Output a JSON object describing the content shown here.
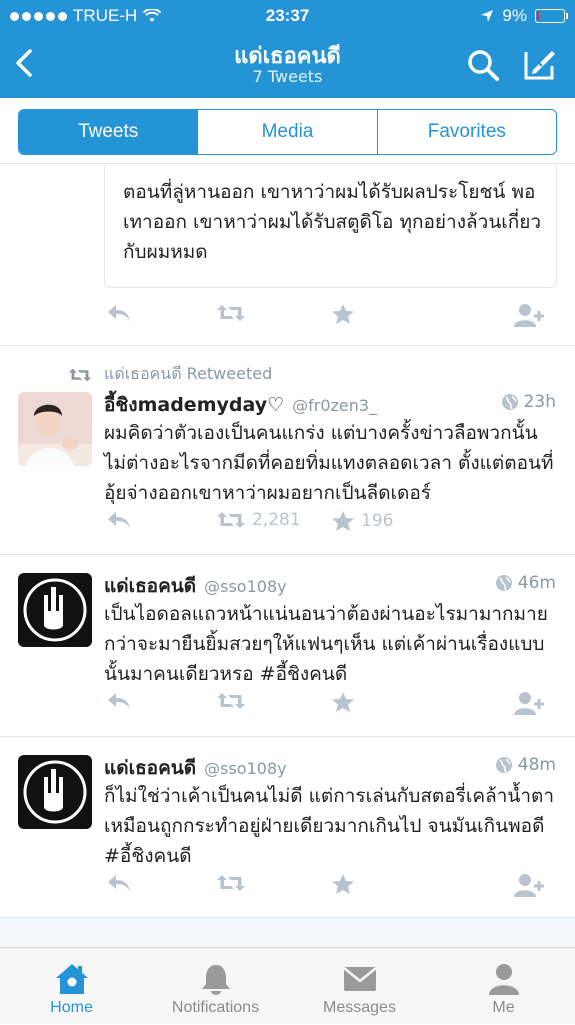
{
  "status_bar": {
    "carrier": "TRUE-H",
    "time": "23:37",
    "battery": "9%",
    "battery_level": 0.09
  },
  "nav": {
    "title": "แด่เธอคนดี",
    "subtitle": "7 Tweets"
  },
  "segments": [
    "Tweets",
    "Media",
    "Favorites"
  ],
  "active_segment": "Tweets",
  "quoted_tweet": {
    "text": "ตอนที่ลู่หานออก เขาหาว่าผมได้รับผลประโยชน์ พอเทาออก เขาหาว่าผมได้รับสตูดิโอ ทุกอย่างล้วนเกี่ยวกับผมหมด"
  },
  "tweets": [
    {
      "retweet_label": "แด่เธอคนดี Retweeted",
      "name": "อี้ชิงmademyday♡",
      "handle": "@fr0zen3_",
      "time": "23h",
      "text": "ผมคิดว่าตัวเองเป็นคนแกร่ง แต่บางครั้งข่าวลือพวกนั้นไม่ต่างอะไรจากมีดที่คอยทิ่มแทงตลอดเวลา ตั้งแต่ตอนที่อุ้ยจ่างออกเขาหาว่าผมอยากเป็นลีดเดอร์",
      "retweets": "2,281",
      "favorites": "196"
    },
    {
      "name": "แด่เธอคนดี",
      "handle": "@sso108y",
      "time": "46m",
      "text": "เป็นไอดอลแถวหน้าแน่นอนว่าต้องผ่านอะไรมามากมายกว่าจะมายืนยิ้มสวยๆให้แฟนๆเห็น แต่เค้าผ่านเรื่องแบบนั้นมาคนเดียวหรอ #อี้ชิงคนดี"
    },
    {
      "name": "แด่เธอคนดี",
      "handle": "@sso108y",
      "time": "48m",
      "text": "ก็ไม่ใช่ว่าเค้าเป็นคนไม่ดี แต่การเล่นกับสตอรี่เคล้าน้ำตา เหมือนถูกกระทำอยู่ฝ่ายเดียวมากเกินไป จนมันเกินพอดี #อี้ชิงคนดี"
    }
  ],
  "tabs": [
    {
      "label": "Home",
      "icon": "home-icon"
    },
    {
      "label": "Notifications",
      "icon": "bell-icon"
    },
    {
      "label": "Messages",
      "icon": "envelope-icon"
    },
    {
      "label": "Me",
      "icon": "person-icon"
    }
  ],
  "colors": {
    "brand": "#2594d6",
    "muted": "#8899a6",
    "action": "#b7c4cf"
  }
}
